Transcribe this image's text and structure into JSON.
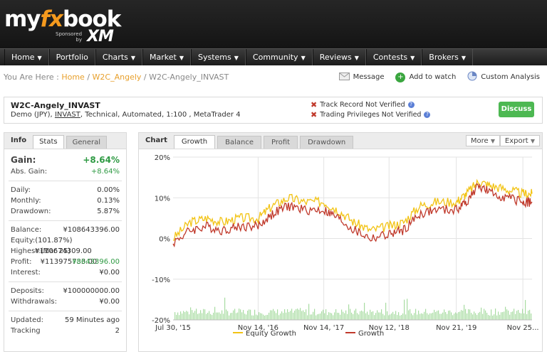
{
  "header": {
    "logo_my": "my",
    "logo_fx": "fx",
    "logo_book": "book",
    "sponsored": "Sponsored",
    "by": "by",
    "sponsor_name": "XM"
  },
  "nav": [
    {
      "label": "Home",
      "caret": true
    },
    {
      "label": "Portfolio",
      "caret": false
    },
    {
      "label": "Charts",
      "caret": true
    },
    {
      "label": "Market",
      "caret": true
    },
    {
      "label": "Systems",
      "caret": true
    },
    {
      "label": "Community",
      "caret": true
    },
    {
      "label": "Reviews",
      "caret": true
    },
    {
      "label": "Contests",
      "caret": true
    },
    {
      "label": "Brokers",
      "caret": true
    }
  ],
  "breadcrumb": {
    "prefix": "You Are Here :",
    "home": "Home",
    "sep": "/",
    "parent": "W2C_Angely",
    "current": "W2C-Angely_INVAST"
  },
  "actions": {
    "message": "Message",
    "watch": "Add to watch",
    "custom": "Custom Analysis"
  },
  "system": {
    "name": "W2C-Angely_INVAST",
    "desc_pre": "Demo (JPY),",
    "broker": "INVAST",
    "desc_post": ", Technical, Automated, 1:100 , MetaTrader 4",
    "track_record": "Track Record Not Verified",
    "privileges": "Trading Privileges Not Verified",
    "discuss": "Discuss"
  },
  "left_panel": {
    "title": "Info",
    "tabs": [
      "Stats",
      "General"
    ],
    "gain_label": "Gain:",
    "gain_value": "+8.64%",
    "abs_gain_label": "Abs. Gain:",
    "abs_gain_value": "+8.64%",
    "stats": [
      {
        "k": "Daily:",
        "v": "0.00%"
      },
      {
        "k": "Monthly:",
        "v": "0.13%"
      },
      {
        "k": "Drawdown:",
        "v": "5.87%"
      }
    ],
    "balance": [
      {
        "k": "Balance:",
        "v": "¥108643396.00",
        "green": false
      },
      {
        "k": "Equity:",
        "v": "(101.87%) ¥110674309.00",
        "green": false
      },
      {
        "k": "Highest:",
        "v": "(Mar 25) ¥113975733.00",
        "green": false
      },
      {
        "k": "Profit:",
        "v": "¥8643396.00",
        "green": true
      },
      {
        "k": "Interest:",
        "v": "¥0.00",
        "green": false
      }
    ],
    "deposits": [
      {
        "k": "Deposits:",
        "v": "¥100000000.00"
      },
      {
        "k": "Withdrawals:",
        "v": "¥0.00"
      }
    ],
    "meta": [
      {
        "k": "Updated:",
        "v": "59 Minutes ago"
      },
      {
        "k": "Tracking",
        "v": "2"
      }
    ]
  },
  "right_panel": {
    "title": "Chart",
    "tabs": [
      "Growth",
      "Balance",
      "Profit",
      "Drawdown"
    ],
    "more": "More",
    "export": "Export"
  },
  "chart_data": {
    "type": "line",
    "x_ticks": [
      "Jul 30, '15",
      "Nov 14, '16",
      "Nov 14, '17",
      "Nov 12, '18",
      "Nov 21, '19",
      "Nov 25..."
    ],
    "y_ticks": [
      "20%",
      "10%",
      "0%",
      "-10%",
      "-20%"
    ],
    "ylim": [
      -20,
      20
    ],
    "grid": true,
    "legend_position": "bottom",
    "series": [
      {
        "name": "Equity Growth",
        "color": "#f2c314",
        "x": [
          "2015-07-30",
          "2015-11-01",
          "2016-02-01",
          "2016-05-01",
          "2016-08-01",
          "2016-11-14",
          "2017-02-01",
          "2017-05-01",
          "2017-08-01",
          "2017-11-14",
          "2018-02-01",
          "2018-05-01",
          "2018-08-01",
          "2018-11-12",
          "2019-02-01",
          "2019-05-01",
          "2019-08-01",
          "2019-11-21",
          "2020-01-15",
          "2020-03-25",
          "2020-06-01",
          "2020-09-01",
          "2020-11-25",
          "2021-01-15"
        ],
        "values": [
          0,
          4,
          5,
          4,
          5,
          5,
          8,
          10,
          9,
          9,
          7,
          4,
          2,
          3,
          4,
          8,
          9,
          9,
          11,
          14,
          13,
          12,
          11,
          11
        ]
      },
      {
        "name": "Growth",
        "color": "#c0392b",
        "x": [
          "2015-07-30",
          "2015-11-01",
          "2016-02-01",
          "2016-05-01",
          "2016-08-01",
          "2016-11-14",
          "2017-02-01",
          "2017-05-01",
          "2017-08-01",
          "2017-11-14",
          "2018-02-01",
          "2018-05-01",
          "2018-08-01",
          "2018-11-12",
          "2019-02-01",
          "2019-05-01",
          "2019-08-01",
          "2019-11-21",
          "2020-01-15",
          "2020-03-25",
          "2020-06-01",
          "2020-09-01",
          "2020-11-25",
          "2021-01-15"
        ],
        "values": [
          -1,
          2,
          3,
          2,
          3,
          3,
          6,
          8,
          7,
          7,
          5,
          2,
          0,
          1,
          2,
          6,
          7,
          7,
          9,
          13,
          11,
          10,
          9,
          9
        ]
      }
    ]
  }
}
